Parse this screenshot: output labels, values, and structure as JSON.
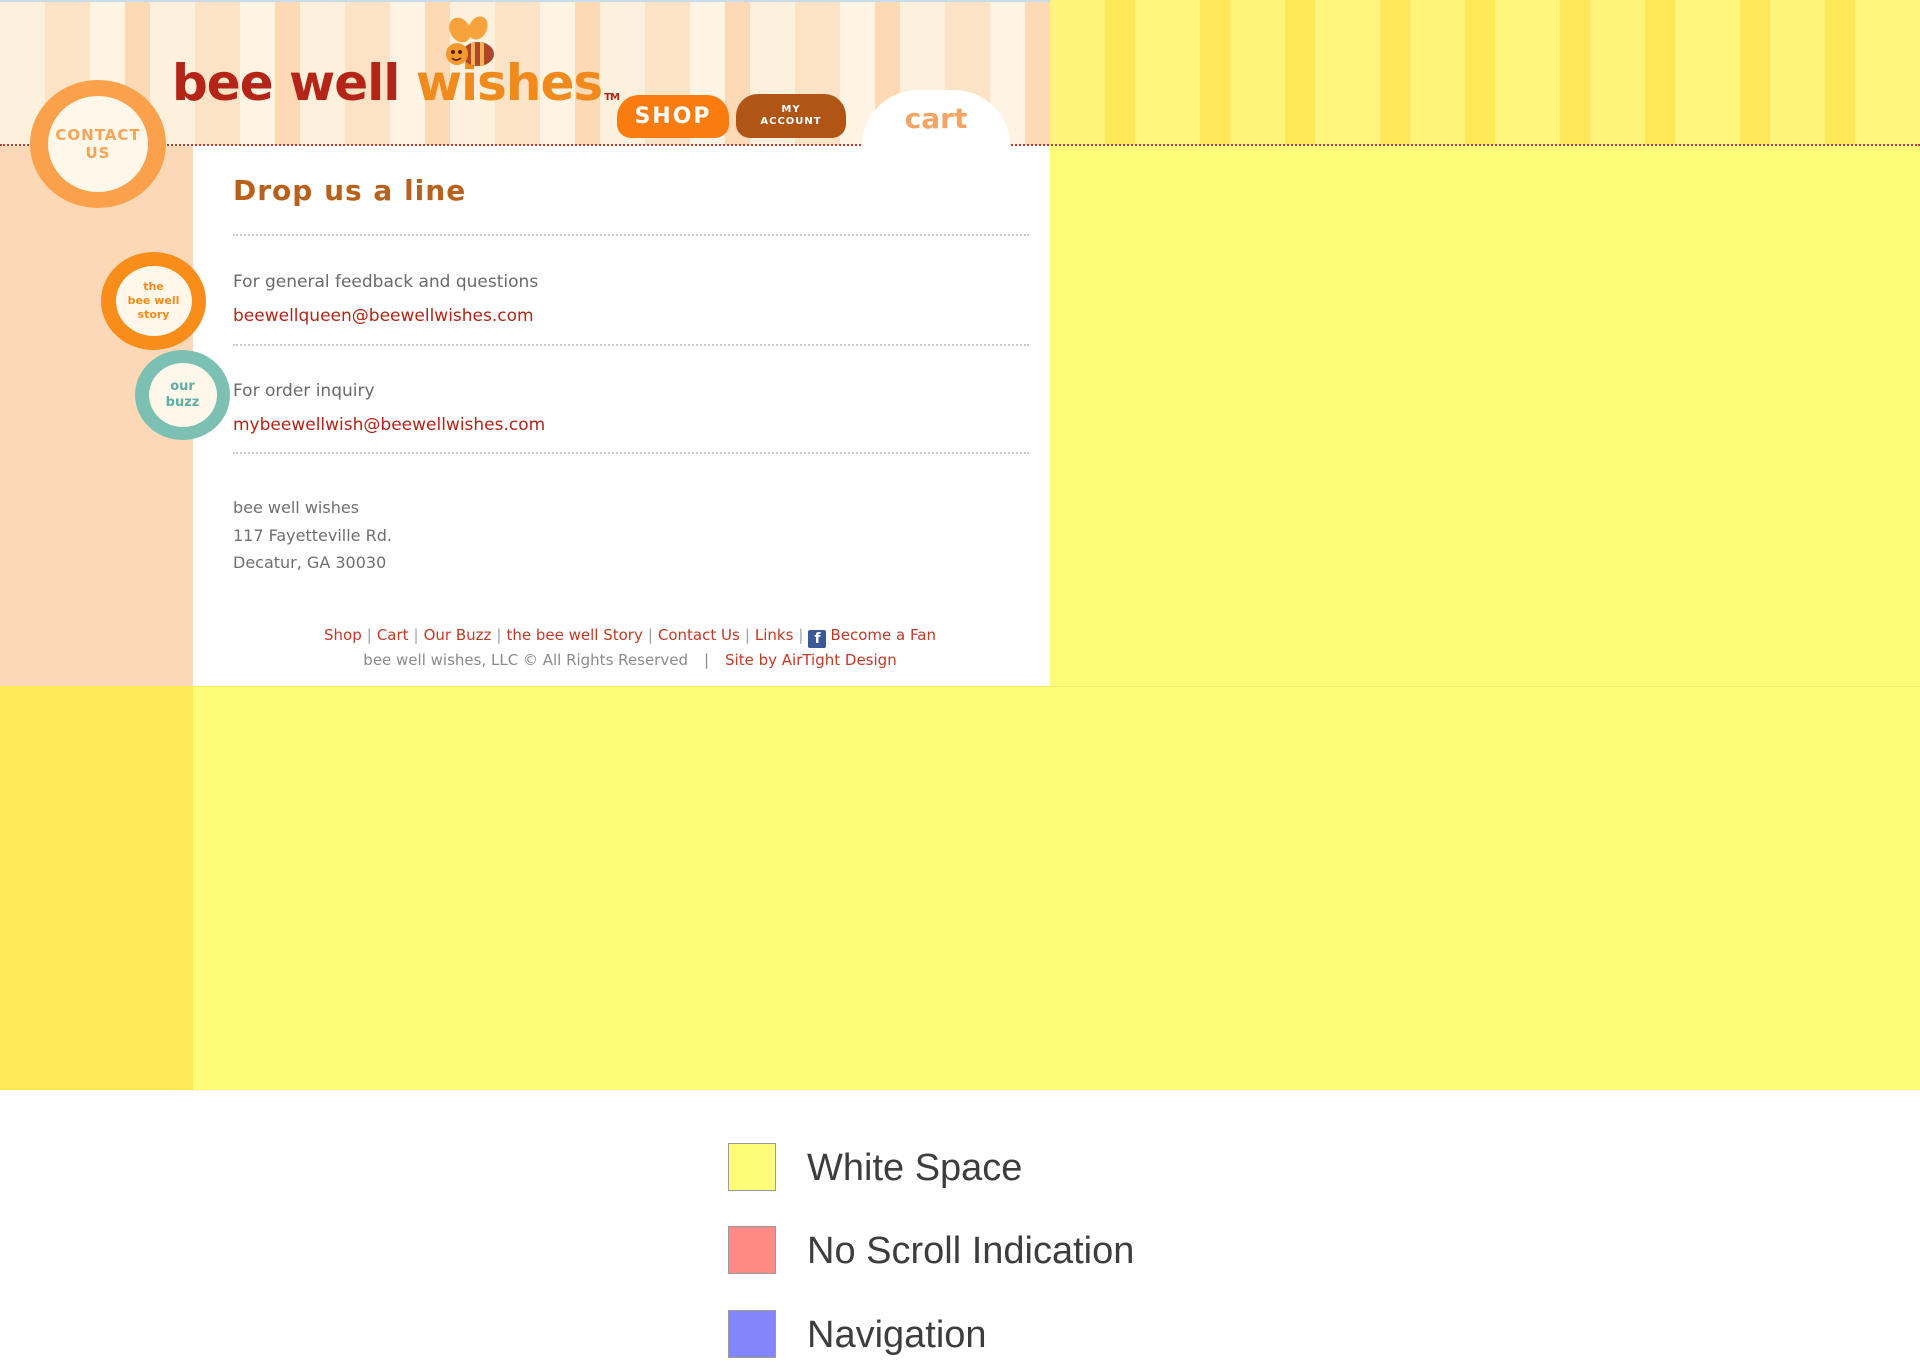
{
  "brand": {
    "logo_text_a": "bee well ",
    "logo_text_b": "wishes",
    "logo_tm": "TM",
    "color_red": "#b42417",
    "color_orange": "#f08a1c"
  },
  "nav": {
    "shop": "SHOP",
    "account_line1": "MY",
    "account_line2": "ACCOUNT",
    "cart": "cart"
  },
  "badges": {
    "contact_line1": "CONTACT",
    "contact_line2": "US",
    "story_line1": "the",
    "story_line2": "bee well",
    "story_line3": "story",
    "buzz_line1": "our",
    "buzz_line2": "buzz"
  },
  "content": {
    "title": "Drop us a line",
    "general_label": "For general feedback and questions",
    "general_email": "beewellqueen@beewellwishes.com",
    "order_label": "For order inquiry",
    "order_email": "mybeewellwish@beewellwishes.com",
    "address": {
      "name": "bee well wishes",
      "street": "117 Fayetteville Rd.",
      "city": "Decatur, GA 30030"
    }
  },
  "footer": {
    "links": [
      "Shop",
      "Cart",
      "Our Buzz",
      "the bee well Story",
      "Contact Us",
      "Links"
    ],
    "fan": "Become a Fan",
    "fb_glyph": "f",
    "copyright": "bee well wishes, LLC © All Rights Reserved",
    "credit": "Site by AirTight Design"
  },
  "legend": {
    "items": [
      {
        "label": "White Space",
        "color": "#fffc7a"
      },
      {
        "label": "No Scroll Indication",
        "color": "#fd8a84"
      },
      {
        "label": "Navigation",
        "color": "#8585fb"
      }
    ]
  }
}
